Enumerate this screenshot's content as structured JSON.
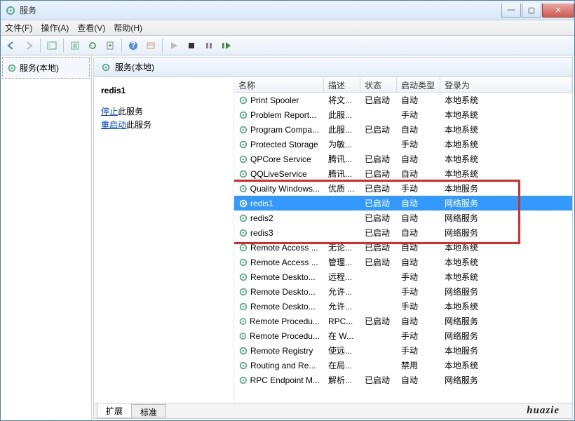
{
  "window": {
    "title": "服务"
  },
  "menu": {
    "file": "文件(F)",
    "action": "操作(A)",
    "view": "查看(V)",
    "help": "帮助(H)"
  },
  "tree": {
    "root": "服务(本地)"
  },
  "panel": {
    "heading": "服务(本地)",
    "selected_name": "redis1",
    "stop_link": "停止",
    "stop_suffix": "此服务",
    "restart_link": "重启动",
    "restart_suffix": "此服务"
  },
  "columns": {
    "name": "名称",
    "desc": "描述",
    "status": "状态",
    "startup": "启动类型",
    "logon": "登录为"
  },
  "rows": [
    {
      "name": "Print Spooler",
      "desc": "将文...",
      "status": "已启动",
      "startup": "自动",
      "logon": "本地系统"
    },
    {
      "name": "Problem Report...",
      "desc": "此服...",
      "status": "",
      "startup": "手动",
      "logon": "本地系统"
    },
    {
      "name": "Program Compa...",
      "desc": "此服...",
      "status": "已启动",
      "startup": "自动",
      "logon": "本地系统"
    },
    {
      "name": "Protected Storage",
      "desc": "为敏...",
      "status": "",
      "startup": "手动",
      "logon": "本地系统"
    },
    {
      "name": "QPCore Service",
      "desc": "腾讯...",
      "status": "已启动",
      "startup": "自动",
      "logon": "本地系统"
    },
    {
      "name": "QQLiveService",
      "desc": "腾讯...",
      "status": "已启动",
      "startup": "自动",
      "logon": "本地系统"
    },
    {
      "name": "Quality Windows...",
      "desc": "优质 ...",
      "status": "已启动",
      "startup": "手动",
      "logon": "本地服务"
    },
    {
      "name": "redis1",
      "desc": "",
      "status": "已启动",
      "startup": "自动",
      "logon": "网络服务",
      "selected": true
    },
    {
      "name": "redis2",
      "desc": "",
      "status": "已启动",
      "startup": "自动",
      "logon": "网络服务"
    },
    {
      "name": "redis3",
      "desc": "",
      "status": "已启动",
      "startup": "自动",
      "logon": "网络服务"
    },
    {
      "name": "Remote Access ...",
      "desc": "无论...",
      "status": "已启动",
      "startup": "自动",
      "logon": "本地系统"
    },
    {
      "name": "Remote Access ...",
      "desc": "管理...",
      "status": "已启动",
      "startup": "自动",
      "logon": "本地系统"
    },
    {
      "name": "Remote Deskto...",
      "desc": "远程...",
      "status": "",
      "startup": "手动",
      "logon": "本地系统"
    },
    {
      "name": "Remote Deskto...",
      "desc": "允许...",
      "status": "",
      "startup": "手动",
      "logon": "网络服务"
    },
    {
      "name": "Remote Deskto...",
      "desc": "允许...",
      "status": "",
      "startup": "手动",
      "logon": "本地系统"
    },
    {
      "name": "Remote Procedu...",
      "desc": "RPC...",
      "status": "已启动",
      "startup": "自动",
      "logon": "网络服务"
    },
    {
      "name": "Remote Procedu...",
      "desc": "在 W...",
      "status": "",
      "startup": "手动",
      "logon": "网络服务"
    },
    {
      "name": "Remote Registry",
      "desc": "使远...",
      "status": "",
      "startup": "手动",
      "logon": "本地服务"
    },
    {
      "name": "Routing and Re...",
      "desc": "在局...",
      "status": "",
      "startup": "禁用",
      "logon": "本地系统"
    },
    {
      "name": "RPC Endpoint M...",
      "desc": "解析...",
      "status": "已启动",
      "startup": "自动",
      "logon": "网络服务"
    }
  ],
  "tabs": {
    "extended": "扩展",
    "standard": "标准"
  },
  "watermark": "huazie"
}
